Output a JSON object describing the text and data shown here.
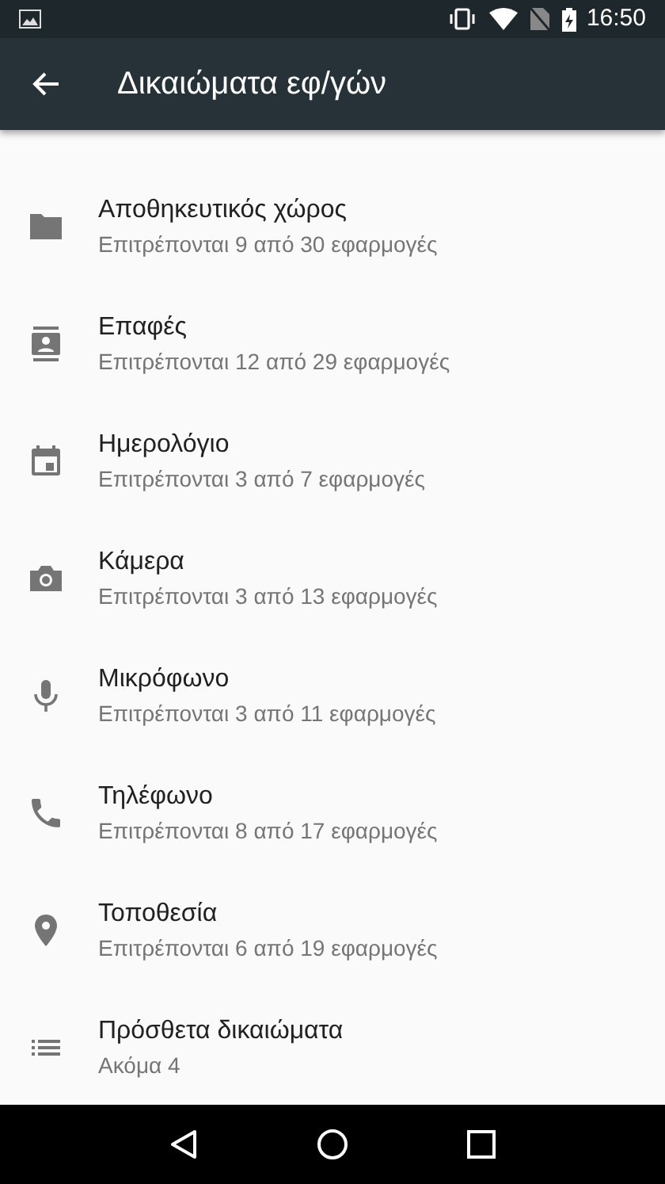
{
  "status_bar": {
    "time": "16:50"
  },
  "app_bar": {
    "title": "Δικαιώματα εφ/γών"
  },
  "items": [
    {
      "kind": "folder",
      "title": "Αποθηκευτικός χώρος",
      "subtitle": "Επιτρέπονται 9 από 30 εφαρμογές"
    },
    {
      "kind": "contacts",
      "title": "Επαφές",
      "subtitle": "Επιτρέπονται 12 από 29 εφαρμογές"
    },
    {
      "kind": "calendar",
      "title": "Ημερολόγιο",
      "subtitle": "Επιτρέπονται 3 από 7 εφαρμογές"
    },
    {
      "kind": "camera",
      "title": "Κάμερα",
      "subtitle": "Επιτρέπονται 3 από 13 εφαρμογές"
    },
    {
      "kind": "mic",
      "title": "Μικρόφωνο",
      "subtitle": "Επιτρέπονται 3 από 11 εφαρμογές"
    },
    {
      "kind": "phone",
      "title": "Τηλέφωνο",
      "subtitle": "Επιτρέπονται 8 από 17 εφαρμογές"
    },
    {
      "kind": "location",
      "title": "Τοποθεσία",
      "subtitle": "Επιτρέπονται 6 από 19 εφαρμογές"
    },
    {
      "kind": "list",
      "title": "Πρόσθετα δικαιώματα",
      "subtitle": "Ακόμα 4"
    }
  ]
}
